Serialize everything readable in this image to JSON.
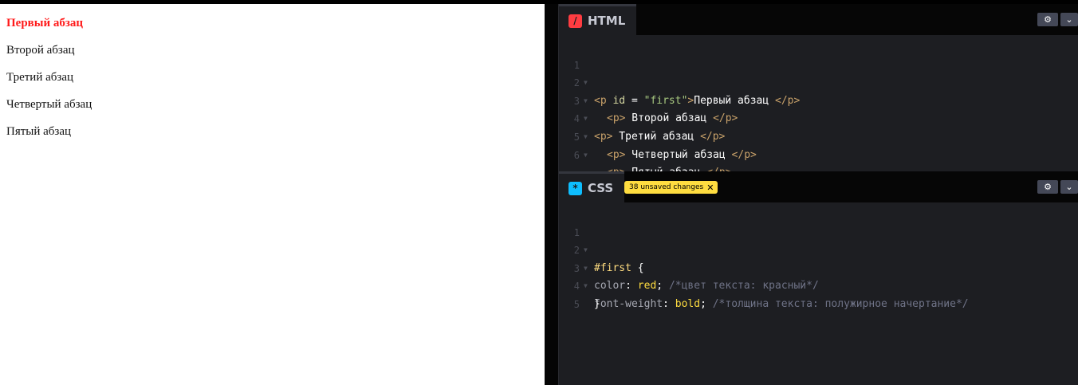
{
  "preview": {
    "paragraphs": [
      "Первый абзац",
      "Второй абзац",
      "Третий абзац",
      "Четвертый абзац",
      "Пятый абзац"
    ]
  },
  "html_editor": {
    "tab_label": "HTML",
    "icon": "slash-icon",
    "line_numbers": [
      "1",
      "2",
      "3",
      "4",
      "5",
      "6"
    ],
    "lines": [
      {
        "open": "<p ",
        "attr_name": "id",
        "eq": " = ",
        "attr_value": "\"first\"",
        "close": ">",
        "text": "Первый абзац ",
        "end": "</p>"
      },
      {
        "open": "<p>",
        "text": " Второй абзац ",
        "end": "</p>"
      },
      {
        "open": "<p>",
        "text": " Третий абзац ",
        "end": "</p>"
      },
      {
        "open": "<p>",
        "text": " Четвертый абзац ",
        "end": "</p>"
      },
      {
        "open": "<p>",
        "text": " Пятый абзац ",
        "end": "</p>"
      }
    ]
  },
  "css_editor": {
    "tab_label": "CSS",
    "icon": "asterisk-icon",
    "unsaved_label": "38 unsaved changes",
    "line_numbers": [
      "1",
      "2",
      "3",
      "4",
      "5"
    ],
    "selector": "#first",
    "open_brace": " {",
    "close_brace": "}",
    "decl1": {
      "prop": "color",
      "value": "red",
      "comment": "/*цвет текста: красный*/"
    },
    "decl2": {
      "prop": "font-weight",
      "value": "bold",
      "comment": "/*толщина текста: полужирное начертание*/"
    }
  },
  "colors": {
    "highlight_red": "#ff1a1a",
    "unsaved_badge": "#ffdd40",
    "editor_bg": "#1d1e22"
  }
}
